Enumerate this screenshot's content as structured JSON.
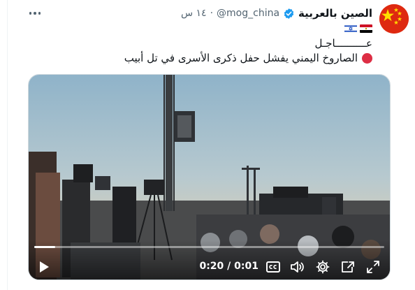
{
  "tweet": {
    "display_name": "الصين بالعربية",
    "handle": "@mog_china",
    "separator": "·",
    "time": "١٤ س",
    "flags": [
      "egypt-flag",
      "israel-flag"
    ],
    "text_line1": "عــــــــــاجـل",
    "text_line2": "الصاروخ اليمني يفشل حفل ذكرى الأسرى في تل أبيب"
  },
  "media": {
    "elapsed": "0:20",
    "separator": "/",
    "duration": "0:01",
    "progress": 0.06
  },
  "colors": {
    "text_primary": "#0f1419",
    "text_secondary": "#536471",
    "verified_blue": "#1d9bf0",
    "avatar_red": "#de2910",
    "star_yellow": "#ffde00"
  },
  "icons": {
    "more": "more-horizontal-icon",
    "verified": "verified-badge-icon",
    "red_circle": "red-circle-emoji-icon",
    "play": "play-icon",
    "captions": "closed-captions-icon",
    "volume": "volume-icon",
    "settings": "gear-icon",
    "pip": "picture-in-picture-icon",
    "fullscreen": "fullscreen-icon"
  }
}
